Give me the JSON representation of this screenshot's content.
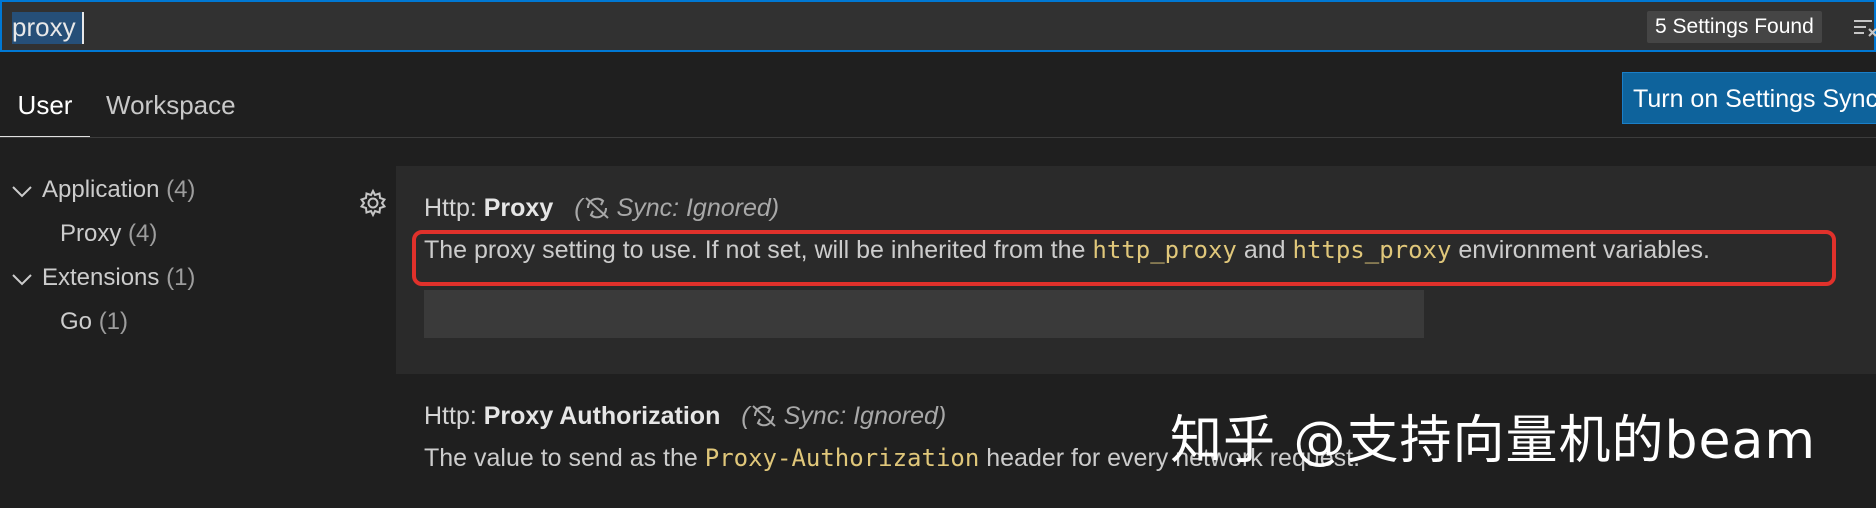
{
  "search": {
    "value": "proxy",
    "results_badge": "5 Settings Found"
  },
  "tabs": [
    {
      "label": "User",
      "active": true
    },
    {
      "label": "Workspace",
      "active": false
    }
  ],
  "sync_button": {
    "label": "Turn on Settings Sync"
  },
  "toc": [
    {
      "label": "Application",
      "count": "(4)",
      "expanded": true,
      "level": 0
    },
    {
      "label": "Proxy",
      "count": "(4)",
      "level": 1
    },
    {
      "label": "Extensions",
      "count": "(1)",
      "expanded": true,
      "level": 0
    },
    {
      "label": "Go",
      "count": "(1)",
      "level": 1
    }
  ],
  "settings": [
    {
      "category": "Http: ",
      "key": "Proxy",
      "sync_note": "Sync: Ignored)",
      "sync_note_prefix": "(",
      "desc_pre": "The proxy setting to use. If not set, will be inherited from the ",
      "code1": "http_proxy",
      "desc_mid": " and ",
      "code2": "https_proxy",
      "desc_post": " environment variables.",
      "value": ""
    },
    {
      "category": "Http: ",
      "key": "Proxy Authorization",
      "sync_note": "Sync: Ignored)",
      "sync_note_prefix": "(",
      "desc_pre": "The value to send as the ",
      "code1": "Proxy-Authorization",
      "desc_post": " header for every network request."
    }
  ],
  "watermark": "知乎 @支持向量机的beam",
  "colors": {
    "accent": "#0078d4",
    "button": "#0e639c",
    "code": "#e0c77a",
    "annotation": "#e0312b"
  }
}
